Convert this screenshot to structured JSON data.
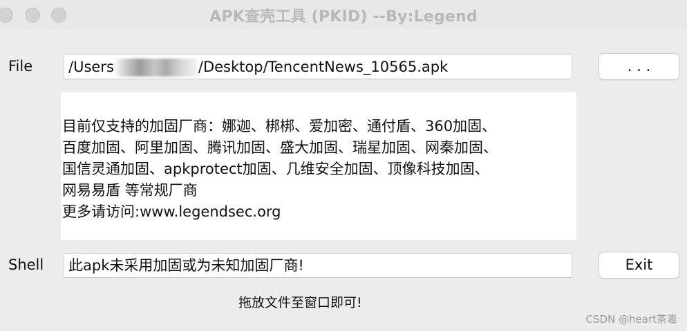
{
  "window": {
    "title": "APK查壳工具 (PKID) --By:Legend"
  },
  "file": {
    "label": "File",
    "path_prefix": "/Users",
    "path_suffix": "/Desktop/TencentNews_10565.apk",
    "browse_label": ". . ."
  },
  "info": {
    "lines": [
      "目前仅支持的加固厂商：娜迦、梆梆、爱加密、通付盾、360加固、",
      "百度加固、阿里加固、腾讯加固、盛大加固、瑞星加固、网秦加固、",
      "国信灵通加固、apkprotect加固、几维安全加固、顶像科技加固、",
      "网易易盾 等常规厂商",
      "更多请访问:www.legendsec.org"
    ]
  },
  "shell": {
    "label": "Shell",
    "value": "此apk未采用加固或为未知加固厂商!",
    "exit_label": "Exit"
  },
  "hint": "拖放文件至窗口即可!",
  "watermark": "CSDN @heart茶毒"
}
